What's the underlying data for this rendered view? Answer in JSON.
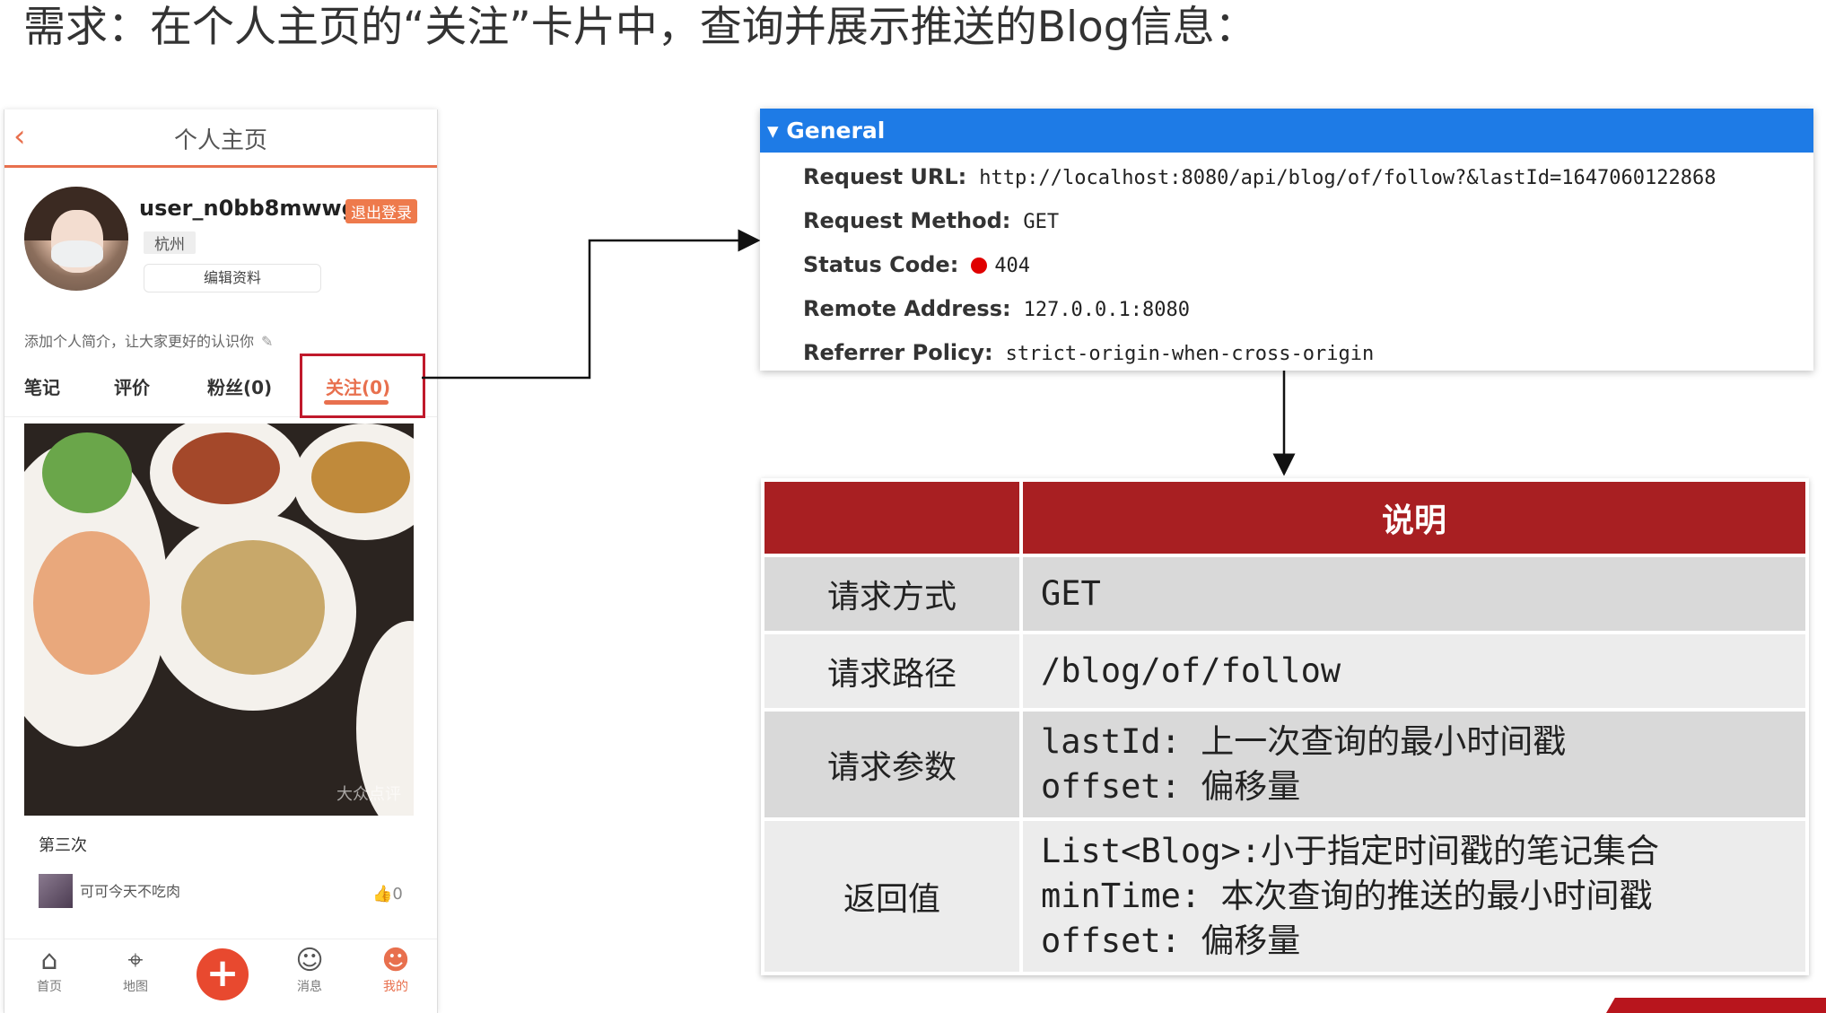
{
  "heading": "需求：在个人主页的“关注”卡片中，查询并展示推送的Blog信息：",
  "phone": {
    "back_icon": "‹",
    "title": "个人主页",
    "username": "user_n0bb8mwwg4",
    "logout_label": "退出登录",
    "city": "杭州",
    "edit_label": "编辑资料",
    "bio": "添加个人简介，让大家更好的认识你",
    "tabs": [
      "笔记",
      "评价",
      "粉丝(0)",
      "关注(0)"
    ],
    "active_tab": "关注(0)",
    "card_title": "第三次",
    "card_author": "可可今天不吃肉",
    "like_count": "0",
    "watermark": "大众点评",
    "nav": [
      {
        "label": "首页",
        "icon": "home-icon"
      },
      {
        "label": "地图",
        "icon": "map-pin-icon"
      },
      {
        "label": "",
        "icon": "plus-icon"
      },
      {
        "label": "消息",
        "icon": "message-icon"
      },
      {
        "label": "我的",
        "icon": "user-icon"
      }
    ],
    "accent_color": "#e8704e"
  },
  "general": {
    "header": "General",
    "rows": [
      {
        "key": "Request URL:",
        "value": "http://localhost:8080/api/blog/of/follow?&lastId=1647060122868"
      },
      {
        "key": "Request Method:",
        "value": "GET"
      },
      {
        "key": "Status Code:",
        "value": "404"
      },
      {
        "key": "Remote Address:",
        "value": "127.0.0.1:8080"
      },
      {
        "key": "Referrer Policy:",
        "value": "strict-origin-when-cross-origin"
      }
    ],
    "header_color": "#1e7be6"
  },
  "spec_table": {
    "header": "说明",
    "rows": [
      {
        "label": "请求方式",
        "lines": [
          "GET"
        ]
      },
      {
        "label": "请求路径",
        "lines": [
          "/blog/of/follow"
        ]
      },
      {
        "label": "请求参数",
        "lines": [
          "lastId: 上一次查询的最小时间戳",
          "offset: 偏移量"
        ]
      },
      {
        "label": "返回值",
        "lines": [
          "List<Blog>:小于指定时间戳的笔记集合",
          "minTime: 本次查询的推送的最小时间戳",
          "offset: 偏移量"
        ]
      }
    ],
    "header_color": "#a81f22"
  }
}
